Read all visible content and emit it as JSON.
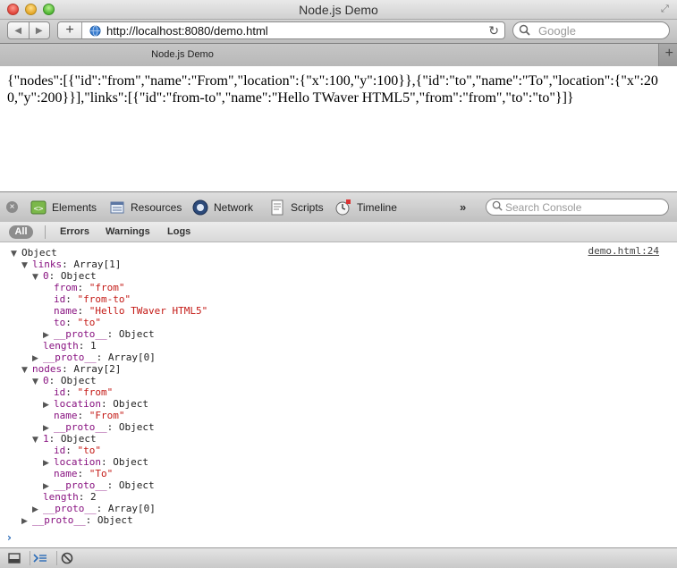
{
  "window": {
    "title": "Node.js Demo"
  },
  "toolbar": {
    "url": "http://localhost:8080/demo.html",
    "search_placeholder": "Google"
  },
  "tabs": [
    {
      "label": "Node.js Demo",
      "active": true
    }
  ],
  "page": {
    "json_text": "{\"nodes\":[{\"id\":\"from\",\"name\":\"From\",\"location\":{\"x\":100,\"y\":100}},{\"id\":\"to\",\"name\":\"To\",\"location\":{\"x\":200,\"y\":200}}],\"links\":[{\"id\":\"from-to\",\"name\":\"Hello TWaver HTML5\",\"from\":\"from\",\"to\":\"to\"}]}"
  },
  "devtools": {
    "panels": [
      "Elements",
      "Resources",
      "Network",
      "Scripts",
      "Timeline"
    ],
    "more": "»",
    "search_placeholder": "Search Console",
    "filters": [
      "All",
      "Errors",
      "Warnings",
      "Logs"
    ],
    "source_link": "demo.html:24",
    "prompt": "›",
    "lines": [
      {
        "indent": 0,
        "tri": "▼",
        "key": "",
        "sep": "",
        "value": "Object",
        "vtype": "plain"
      },
      {
        "indent": 1,
        "tri": "▼",
        "key": "links",
        "sep": ": ",
        "value": "Array[1]",
        "vtype": "plain"
      },
      {
        "indent": 2,
        "tri": "▼",
        "key": "0",
        "sep": ": ",
        "value": "Object",
        "vtype": "plain"
      },
      {
        "indent": 3,
        "tri": "",
        "key": "from",
        "sep": ": ",
        "value": "\"from\"",
        "vtype": "str"
      },
      {
        "indent": 3,
        "tri": "",
        "key": "id",
        "sep": ": ",
        "value": "\"from-to\"",
        "vtype": "str"
      },
      {
        "indent": 3,
        "tri": "",
        "key": "name",
        "sep": ": ",
        "value": "\"Hello TWaver HTML5\"",
        "vtype": "str"
      },
      {
        "indent": 3,
        "tri": "",
        "key": "to",
        "sep": ": ",
        "value": "\"to\"",
        "vtype": "str"
      },
      {
        "indent": 3,
        "tri": "▶",
        "key": "__proto__",
        "sep": ": ",
        "value": "Object",
        "vtype": "plain"
      },
      {
        "indent": 2,
        "tri": "",
        "key": "length",
        "sep": ": ",
        "value": "1",
        "vtype": "plain"
      },
      {
        "indent": 2,
        "tri": "▶",
        "key": "__proto__",
        "sep": ": ",
        "value": "Array[0]",
        "vtype": "plain"
      },
      {
        "indent": 1,
        "tri": "▼",
        "key": "nodes",
        "sep": ": ",
        "value": "Array[2]",
        "vtype": "plain"
      },
      {
        "indent": 2,
        "tri": "▼",
        "key": "0",
        "sep": ": ",
        "value": "Object",
        "vtype": "plain"
      },
      {
        "indent": 3,
        "tri": "",
        "key": "id",
        "sep": ": ",
        "value": "\"from\"",
        "vtype": "str"
      },
      {
        "indent": 3,
        "tri": "▶",
        "key": "location",
        "sep": ": ",
        "value": "Object",
        "vtype": "plain"
      },
      {
        "indent": 3,
        "tri": "",
        "key": "name",
        "sep": ": ",
        "value": "\"From\"",
        "vtype": "str"
      },
      {
        "indent": 3,
        "tri": "▶",
        "key": "__proto__",
        "sep": ": ",
        "value": "Object",
        "vtype": "plain"
      },
      {
        "indent": 2,
        "tri": "▼",
        "key": "1",
        "sep": ": ",
        "value": "Object",
        "vtype": "plain"
      },
      {
        "indent": 3,
        "tri": "",
        "key": "id",
        "sep": ": ",
        "value": "\"to\"",
        "vtype": "str"
      },
      {
        "indent": 3,
        "tri": "▶",
        "key": "location",
        "sep": ": ",
        "value": "Object",
        "vtype": "plain"
      },
      {
        "indent": 3,
        "tri": "",
        "key": "name",
        "sep": ": ",
        "value": "\"To\"",
        "vtype": "str"
      },
      {
        "indent": 3,
        "tri": "▶",
        "key": "__proto__",
        "sep": ": ",
        "value": "Object",
        "vtype": "plain"
      },
      {
        "indent": 2,
        "tri": "",
        "key": "length",
        "sep": ": ",
        "value": "2",
        "vtype": "plain"
      },
      {
        "indent": 2,
        "tri": "▶",
        "key": "__proto__",
        "sep": ": ",
        "value": "Array[0]",
        "vtype": "plain"
      },
      {
        "indent": 1,
        "tri": "▶",
        "key": "__proto__",
        "sep": ": ",
        "value": "Object",
        "vtype": "plain"
      }
    ]
  },
  "colors": {
    "key": "#881280",
    "string": "#c41a16",
    "prompt": "#2b6cb8"
  },
  "icons": {
    "nav_back": "back-arrow-icon",
    "nav_forward": "forward-arrow-icon",
    "reload": "reload-icon",
    "globe": "globe-icon",
    "search": "search-icon",
    "dock": "dock-icon",
    "console_toggle": "console-icon",
    "clear": "clear-console-icon"
  }
}
